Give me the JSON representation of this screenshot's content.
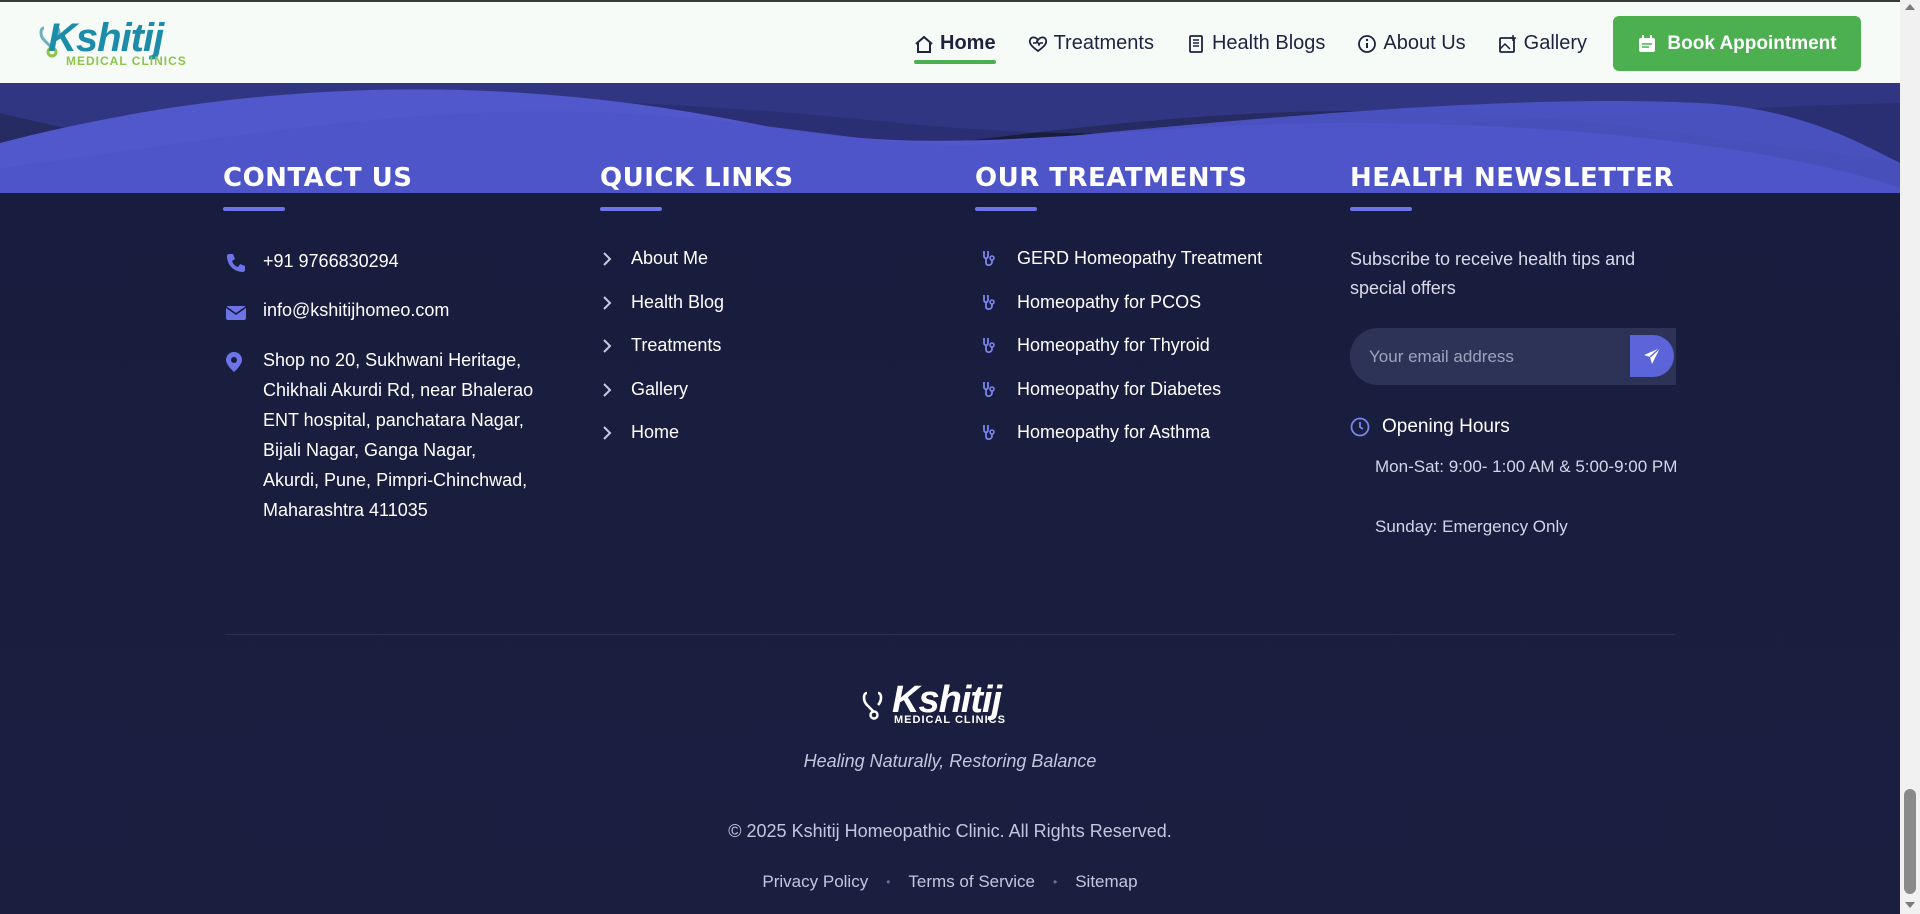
{
  "nav": {
    "logo_text": "Kshitij",
    "logo_sub": "MEDICAL CLINICS",
    "items": [
      {
        "label": "Home",
        "icon": "home-icon",
        "active": true
      },
      {
        "label": "Treatments",
        "icon": "heart-pulse-icon",
        "active": false
      },
      {
        "label": "Health Blogs",
        "icon": "document-icon",
        "active": false
      },
      {
        "label": "About Us",
        "icon": "info-icon",
        "active": false
      },
      {
        "label": "Gallery",
        "icon": "image-icon",
        "active": false
      }
    ],
    "book_label": "Book Appointment"
  },
  "contact": {
    "title": "CONTACT US",
    "phone": "+91 9766830294",
    "email": "info@kshitijhomeo.com",
    "address_lines": [
      "Shop no 20, Sukhwani Heritage,",
      "Chikhali Akurdi Rd, near Bhalerao",
      "ENT hospital, panchatara Nagar,",
      "Bijali Nagar, Ganga Nagar,",
      "Akurdi, Pune, Pimpri-Chinchwad,",
      "Maharashtra 411035"
    ]
  },
  "quick_links": {
    "title": "QUICK LINKS",
    "items": [
      "About Me",
      "Health Blog",
      "Treatments",
      "Gallery",
      "Home"
    ]
  },
  "treatments": {
    "title": "OUR TREATMENTS",
    "items": [
      "GERD Homeopathy Treatment",
      "Homeopathy for PCOS",
      "Homeopathy for Thyroid",
      "Homeopathy for Diabetes",
      "Homeopathy for Asthma"
    ]
  },
  "newsletter": {
    "title": "HEALTH NEWSLETTER",
    "desc": "Subscribe to receive health tips and special offers",
    "placeholder": "Your email address",
    "hours_title": "Opening Hours",
    "hours_weekday": "Mon-Sat: 9:00- 1:00 AM & 5:00-9:00 PM",
    "hours_sunday": "Sunday: Emergency Only"
  },
  "bottom": {
    "logo_text": "Kshitij",
    "logo_sub": "MEDICAL CLINICS",
    "tagline": "Healing Naturally, Restoring Balance",
    "copyright": "© 2025 Kshitij Homeopathic Clinic. All Rights Reserved.",
    "legal": [
      "Privacy Policy",
      "Terms of Service",
      "Sitemap"
    ]
  },
  "colors": {
    "accent_green": "#4caf50",
    "accent_blue": "#5b64d8",
    "footer_bg": "#181c3d"
  }
}
